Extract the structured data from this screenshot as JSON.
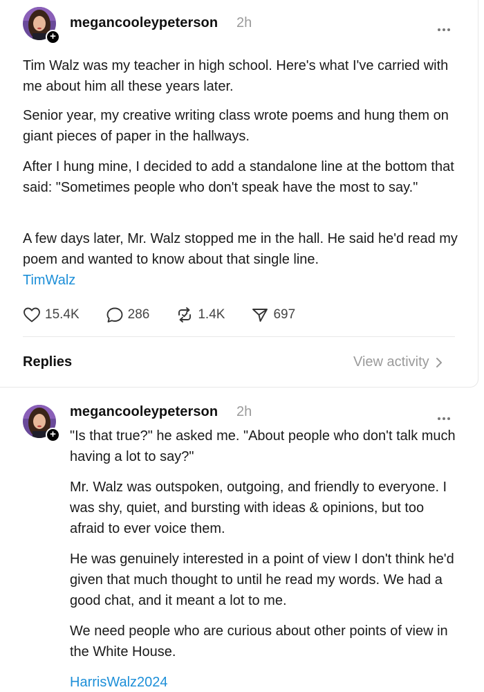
{
  "post": {
    "username": "megancooleypeterson",
    "time": "2h",
    "paragraphs": [
      "Tim Walz was my teacher in high school. Here's what I've carried with me about him all these years later.",
      "Senior year, my creative writing class wrote poems and hung them on giant pieces of paper in the hallways.",
      "After I hung mine, I decided to add a standalone line at the bottom that said: \"Sometimes people who don't speak have the most to say.\"",
      "A few days later, Mr. Walz stopped me in the hall. He said he'd read my poem and wanted to know about that single line."
    ],
    "hashtag": "TimWalz",
    "likes": "15.4K",
    "comments": "286",
    "reposts": "1.4K",
    "shares": "697"
  },
  "replies_header": {
    "label": "Replies",
    "view_activity": "View activity"
  },
  "reply": {
    "username": "megancooleypeterson",
    "time": "2h",
    "paragraphs": [
      "\"Is that true?\" he asked me. \"About people who don't talk much having a lot to say?\"",
      "Mr. Walz was outspoken, outgoing, and friendly to everyone. I was shy, quiet, and bursting with ideas & opinions, but too afraid to ever voice them.",
      "He was genuinely interested in a point of view I don't think he'd given that much thought to until he read my words. We had a good chat, and it meant a lot to me.",
      "We need people who are curious about other points of view in the White House."
    ],
    "hashtag": "HarrisWalz2024"
  },
  "icons": {
    "like": "heart-icon",
    "comment": "comment-icon",
    "repost": "repost-icon",
    "share": "send-icon",
    "more": "more-icon",
    "follow": "plus-icon",
    "chevron": "chevron-right-icon"
  },
  "colors": {
    "hashtag": "#1d8fd8",
    "muted": "#9a9a9a",
    "text": "#1a1a1a"
  }
}
